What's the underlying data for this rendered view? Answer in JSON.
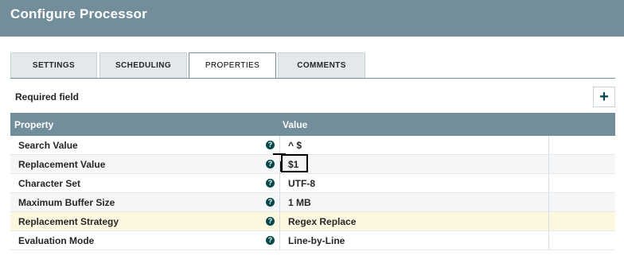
{
  "header": {
    "title": "Configure Processor"
  },
  "tabs": [
    {
      "label": "SETTINGS"
    },
    {
      "label": "SCHEDULING"
    },
    {
      "label": "PROPERTIES"
    },
    {
      "label": "COMMENTS"
    }
  ],
  "active_tab": "PROPERTIES",
  "required_label": "Required field",
  "add_button": {
    "icon": "plus-icon",
    "label": "+"
  },
  "table": {
    "headers": {
      "property": "Property",
      "value": "Value"
    },
    "rows": [
      {
        "name": "Search Value",
        "value": "^ $"
      },
      {
        "name": "Replacement Value",
        "value": "$1"
      },
      {
        "name": "Character Set",
        "value": "UTF-8"
      },
      {
        "name": "Maximum Buffer Size",
        "value": "1 MB"
      },
      {
        "name": "Replacement Strategy",
        "value": "Regex Replace"
      },
      {
        "name": "Evaluation Mode",
        "value": "Line-by-Line"
      }
    ],
    "help_icon": "?"
  },
  "colors": {
    "header_bg": "#728e9b",
    "accent": "#004849",
    "highlight_row": "#fdf7e0"
  }
}
